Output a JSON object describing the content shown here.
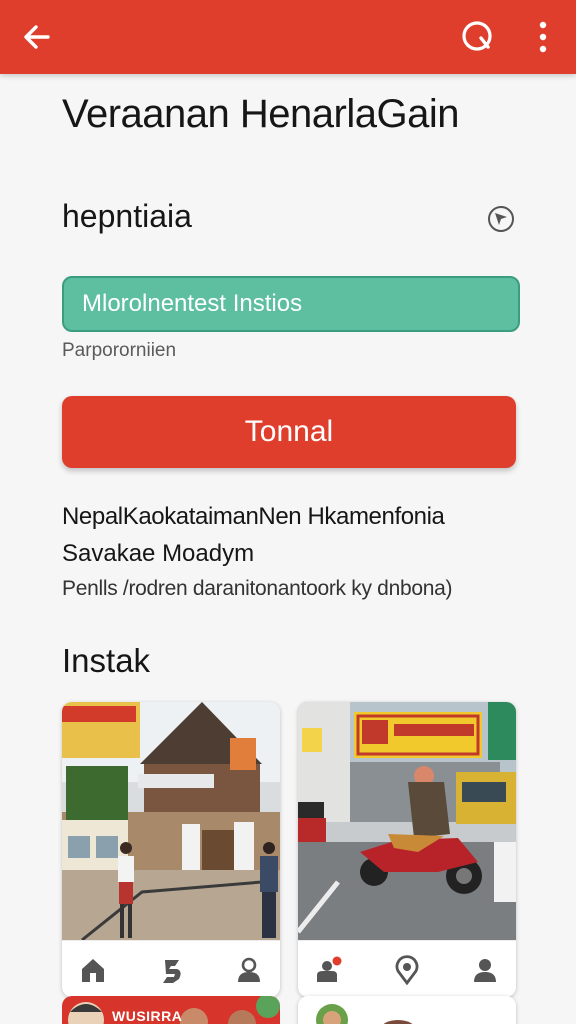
{
  "appbar": {
    "color": "#e03e2d",
    "back_icon": "arrow-left-icon",
    "search_icon": "search-icon",
    "more_icon": "more-vertical-icon"
  },
  "page": {
    "title": "Veraanan HenarlaGain"
  },
  "section": {
    "title": "hepntiaia",
    "icon": "compass-icon"
  },
  "field": {
    "value": "Mlorolnentest Instios",
    "color": "#5dbfa0"
  },
  "hint": "Parpororniien",
  "primary_button": {
    "label": "Tonnal",
    "color": "#e03e2d"
  },
  "description": {
    "line1": "NepalKaokataimanNen Hkamenfonia",
    "line2": "Savakae Moadym",
    "line3": "Penlls /rodren daranitonantoork ky dnbona)"
  },
  "gallery": {
    "title": "Instak",
    "cards": [
      {
        "photo": "street-building-photo",
        "actions": [
          "home-icon",
          "share-icon",
          "person-icon"
        ]
      },
      {
        "photo": "street-motorbike-photo",
        "actions": [
          "person-notification-icon",
          "location-icon",
          "person-icon"
        ]
      }
    ],
    "partial_label": "WUSIRRA"
  }
}
